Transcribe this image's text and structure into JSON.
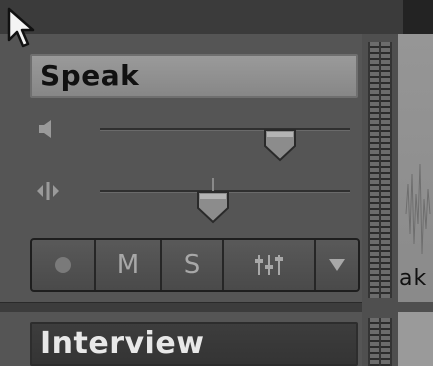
{
  "tracks": [
    {
      "name": "Speak",
      "volume_level": 0.72,
      "pan_level": 0.45,
      "buttons": {
        "record": "",
        "mute": "M",
        "solo": "S",
        "eq": "",
        "menu": ""
      },
      "clip_label_fragment": "ak"
    },
    {
      "name": "Interview"
    }
  ],
  "icons": {
    "cursor": "mouse-pointer-icon",
    "volume": "speaker-icon",
    "pan": "pan-arrows-icon",
    "record": "record-dot-icon",
    "eq": "mixer-sliders-icon",
    "menu": "triangle-down-icon"
  }
}
